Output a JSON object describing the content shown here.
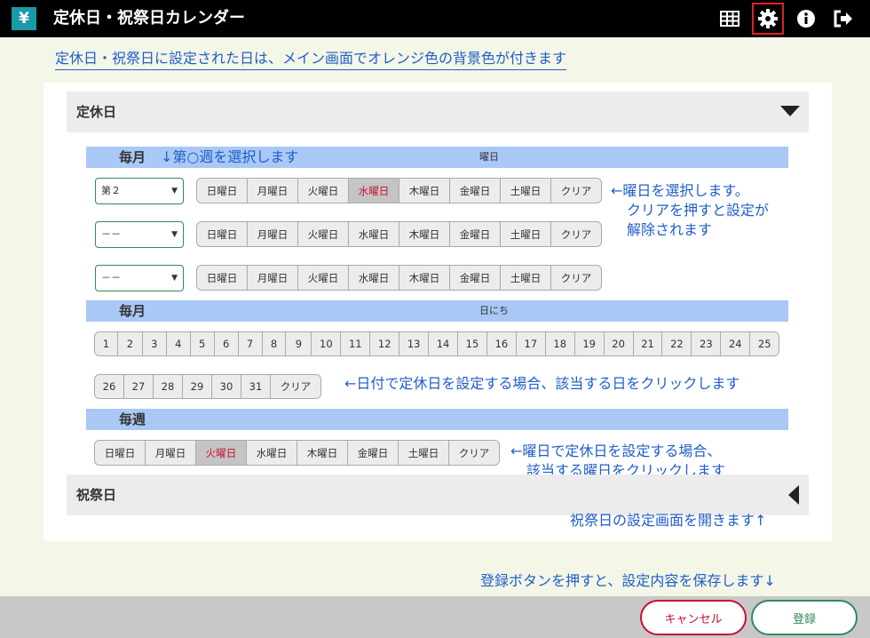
{
  "app": {
    "logo": "¥",
    "title": "定休日・祝祭日カレンダー"
  },
  "toolbar": {
    "icons": [
      "grid-icon",
      "gear-icon",
      "info-icon",
      "logout-icon"
    ],
    "active_icon": "gear-icon"
  },
  "intro": "定休日・祝祭日に設定された日は、メイン画面でオレンジ色の背景色が付きます",
  "teikyubi": {
    "title": "定休日",
    "monthly_week": {
      "title": "毎月",
      "note": "↓第○週を選択します",
      "sub": "曜日",
      "rows": [
        {
          "select": "第２",
          "selected_day": "水曜日"
        },
        {
          "select": "－－",
          "selected_day": ""
        },
        {
          "select": "－－",
          "selected_day": ""
        }
      ]
    },
    "weekday_buttons": [
      "日曜日",
      "月曜日",
      "火曜日",
      "水曜日",
      "木曜日",
      "金曜日",
      "土曜日",
      "クリア"
    ],
    "weekday_note": [
      "←曜日を選択します。",
      "クリアを押すと設定が",
      "解除されます"
    ],
    "monthly_date": {
      "title": "毎月",
      "sub": "日にち",
      "row1": [
        "1",
        "2",
        "3",
        "4",
        "5",
        "6",
        "7",
        "8",
        "9",
        "10",
        "11",
        "12",
        "13",
        "14",
        "15",
        "16",
        "17",
        "18",
        "19",
        "20",
        "21",
        "22",
        "23",
        "24",
        "25"
      ],
      "row2": [
        "26",
        "27",
        "28",
        "29",
        "30",
        "31",
        "クリア"
      ],
      "note": "←日付で定休日を設定する場合、該当する日をクリックします"
    },
    "weekly": {
      "title": "毎週",
      "buttons": [
        "日曜日",
        "月曜日",
        "火曜日",
        "水曜日",
        "木曜日",
        "金曜日",
        "土曜日",
        "クリア"
      ],
      "selected": "火曜日",
      "note": [
        "←曜日で定休日を設定する場合、",
        "該当する曜日をクリックします"
      ]
    }
  },
  "holidays": {
    "title": "祝祭日",
    "note": "祝祭日の設定画面を開きます↑"
  },
  "footer": {
    "note": "登録ボタンを押すと、設定内容を保存します↓",
    "cancel": "キャンセル",
    "save": "登録"
  },
  "colors": {
    "accent": "#1f5ec8",
    "selected_text": "#c8102e",
    "save": "#2e8b57",
    "section_bar": "#a9c8f5"
  }
}
